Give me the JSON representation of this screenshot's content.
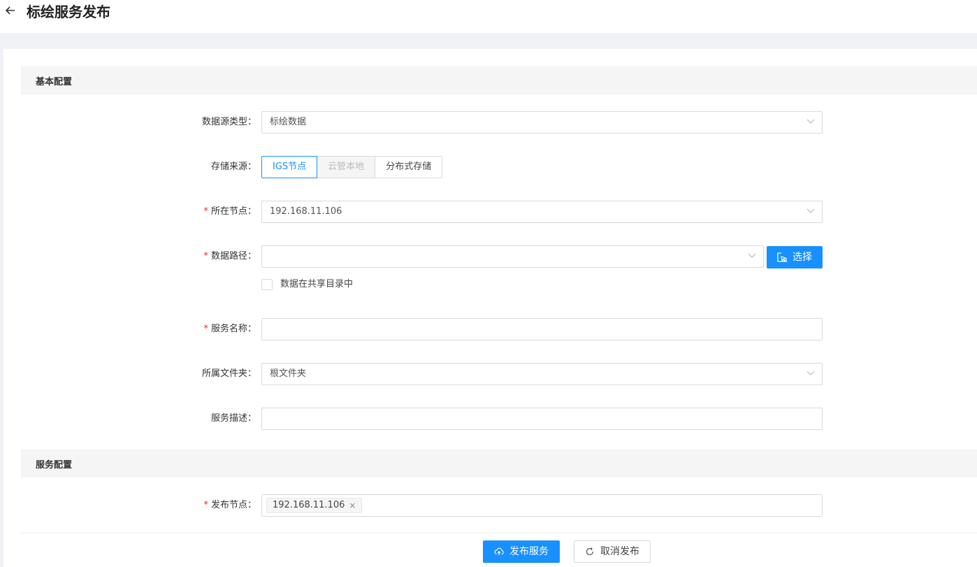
{
  "header": {
    "title": "标绘服务发布"
  },
  "sections": {
    "basic": "基本配置",
    "service": "服务配置"
  },
  "fields": {
    "datasource_type": {
      "label": "数据源类型：",
      "value": "标绘数据"
    },
    "storage_source": {
      "label": "存储来源：",
      "options": [
        "IGS节点",
        "云管本地",
        "分布式存储"
      ]
    },
    "node": {
      "label": "所在节点：",
      "value": "192.168.11.106",
      "required_mark": "*"
    },
    "data_path": {
      "label": "数据路径：",
      "value": "",
      "required_mark": "*",
      "select_button": "选择"
    },
    "shared_dir": {
      "label": "数据在共享目录中",
      "checked": false
    },
    "service_name": {
      "label": "服务名称：",
      "value": "",
      "required_mark": "*"
    },
    "folder": {
      "label": "所属文件夹：",
      "value": "根文件夹"
    },
    "description": {
      "label": "服务描述：",
      "value": ""
    },
    "publish_node": {
      "label": "发布节点：",
      "required_mark": "*",
      "tags": [
        "192.168.11.106"
      ]
    }
  },
  "actions": {
    "publish": "发布服务",
    "cancel": "取消发布"
  },
  "colors": {
    "primary": "#1890ff",
    "required": "#f5222d"
  }
}
